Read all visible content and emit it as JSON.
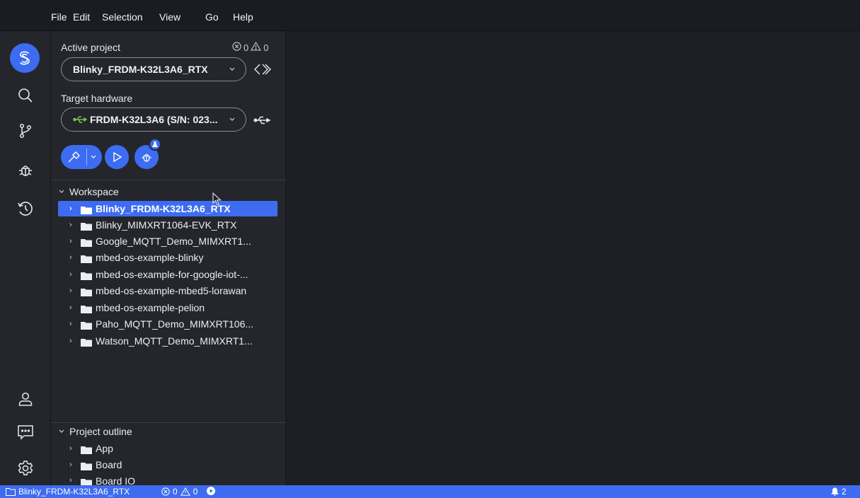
{
  "menu": {
    "items": [
      "File",
      "Edit",
      "Selection",
      "View",
      "Go",
      "Help"
    ]
  },
  "activity_bar": {
    "icons": [
      "studio-logo-icon",
      "search-icon",
      "source-control-icon",
      "debug-icon",
      "history-icon",
      "account-icon",
      "feedback-icon",
      "settings-icon"
    ]
  },
  "sidebar": {
    "active_project_label": "Active project",
    "errors": "0",
    "warnings": "0",
    "active_project_value": "Blinky_FRDM-K32L3A6_RTX",
    "target_hardware_label": "Target hardware",
    "target_hardware_value": "FRDM-K32L3A6 (S/N: 023..."
  },
  "workspace": {
    "title": "Workspace",
    "items": [
      "Blinky_FRDM-K32L3A6_RTX",
      "Blinky_MIMXRT1064-EVK_RTX",
      "Google_MQTT_Demo_MIMXRT1...",
      "mbed-os-example-blinky",
      "mbed-os-example-for-google-iot-...",
      "mbed-os-example-mbed5-lorawan",
      "mbed-os-example-pelion",
      "Paho_MQTT_Demo_MIMXRT106...",
      "Watson_MQTT_Demo_MIMXRT1..."
    ],
    "selected_index": 0
  },
  "outline": {
    "title": "Project outline",
    "items": [
      "App",
      "Board",
      "Board IO"
    ]
  },
  "status_bar": {
    "project": "Blinky_FRDM-K32L3A6_RTX",
    "errors": "0",
    "warnings": "0",
    "notifications": "2"
  },
  "colors": {
    "accent": "#3d6cf0",
    "background": "#1e1f25",
    "panel": "#25262c",
    "usb_green": "#7ec84a"
  }
}
